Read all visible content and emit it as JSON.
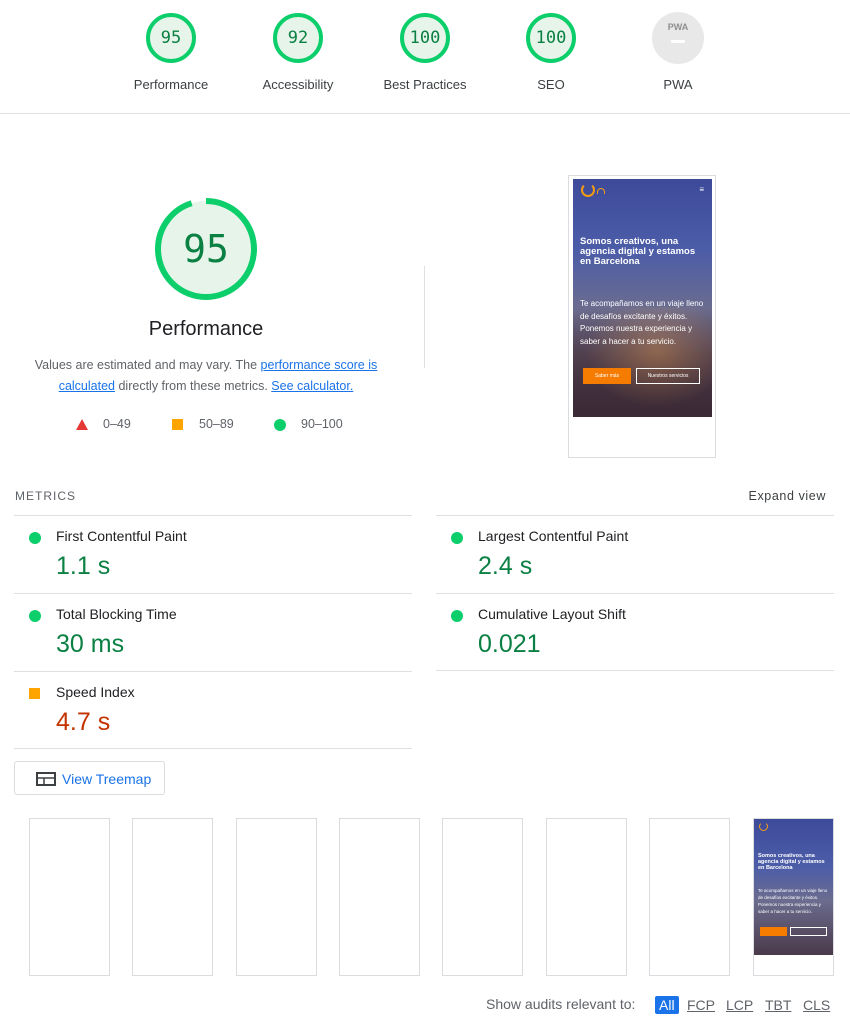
{
  "categories": [
    {
      "label": "Performance",
      "score": "95"
    },
    {
      "label": "Accessibility",
      "score": "92"
    },
    {
      "label": "Best Practices",
      "score": "100"
    },
    {
      "label": "SEO",
      "score": "100"
    },
    {
      "label": "PWA",
      "badge": "PWA"
    }
  ],
  "performance": {
    "score": "95",
    "title": "Performance",
    "desc_prefix": "Values are estimated and may vary. The ",
    "desc_link1": "performance score is calculated",
    "desc_mid": " directly from these metrics. ",
    "desc_link2": "See calculator."
  },
  "legend": [
    {
      "range": "0–49",
      "shape": "triangle",
      "color": "#e53935"
    },
    {
      "range": "50–89",
      "shape": "square",
      "color": "#ffa400"
    },
    {
      "range": "90–100",
      "shape": "circle",
      "color": "#0cce6b"
    }
  ],
  "preview": {
    "headline": "Somos creativos, una agencia digital y estamos en Barcelona",
    "body": "Te acompañamos en un viaje lleno de desafíos excitante y éxitos. Ponemos nuestra experiencia y saber a hacer a tu servicio.",
    "button_primary": "Saber más",
    "button_secondary": "Nuestros servicios",
    "menu_icon": "≡"
  },
  "metrics": {
    "heading": "METRICS",
    "expand": "Expand view",
    "items": [
      {
        "name": "First Contentful Paint",
        "value": "1.1 s",
        "status": "good"
      },
      {
        "name": "Largest Contentful Paint",
        "value": "2.4 s",
        "status": "good"
      },
      {
        "name": "Total Blocking Time",
        "value": "30 ms",
        "status": "good"
      },
      {
        "name": "Cumulative Layout Shift",
        "value": "0.021",
        "status": "good"
      },
      {
        "name": "Speed Index",
        "value": "4.7 s",
        "status": "average"
      }
    ]
  },
  "treemap": {
    "label": "View Treemap",
    "icon": "treemap-icon"
  },
  "filter": {
    "label": "Show audits relevant to:",
    "chips": [
      "All",
      "FCP",
      "LCP",
      "TBT",
      "CLS"
    ]
  },
  "colors": {
    "pass": "#0cce6b",
    "pass_text": "#0b8043",
    "average": "#ffa400",
    "average_text": "#c33300",
    "fail": "#e53935",
    "link": "#1a73e8"
  }
}
